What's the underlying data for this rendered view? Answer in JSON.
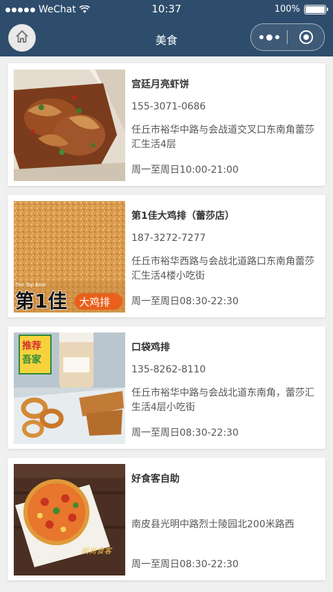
{
  "status_bar": {
    "signal": "●●●●●",
    "carrier": "WeChat",
    "time": "10:37",
    "battery": "100%"
  },
  "nav": {
    "title": "美食"
  },
  "restaurants": [
    {
      "name": "宫廷月亮虾饼",
      "phone": "155-3071-0686",
      "address": "任丘市裕华中路与会战道交叉口东南角蕾莎汇生活4层",
      "hours": "周一至周日10:00-21:00"
    },
    {
      "name": "第1佳大鸡排（蕾莎店）",
      "phone": "187-3272-7277",
      "address": "任丘市裕华西路与会战北道路口东南角蕾莎汇生活4楼小吃街",
      "hours": "周一至周日08:30-22:30",
      "image_text": {
        "top": "The Top Best",
        "brand": "第1佳",
        "sub": "大鸡排"
      }
    },
    {
      "name": "口袋鸡排",
      "phone": "135-8262-8110",
      "address": "任丘市裕华中路与会战北道东南角，蕾莎汇生活4层小吃街",
      "hours": "周一至周日08:30-22:30",
      "image_text": {
        "tag": "推荐",
        "tag2": "吾家"
      }
    },
    {
      "name": "好食客自助",
      "phone": "",
      "address": "南皮县光明中路烈士陵园北200米路西",
      "hours": "周一至周日08:30-22:30",
      "image_text": {
        "brand": "尚尚食客"
      }
    }
  ],
  "colors": {
    "nav_bg": "#2e4d6c",
    "page_bg": "#f0f0f0",
    "card_bg": "#ffffff"
  },
  "icons": [
    "signal-dots",
    "wifi-icon",
    "battery-icon",
    "home-icon",
    "more-icon",
    "close-mini-program-icon"
  ]
}
